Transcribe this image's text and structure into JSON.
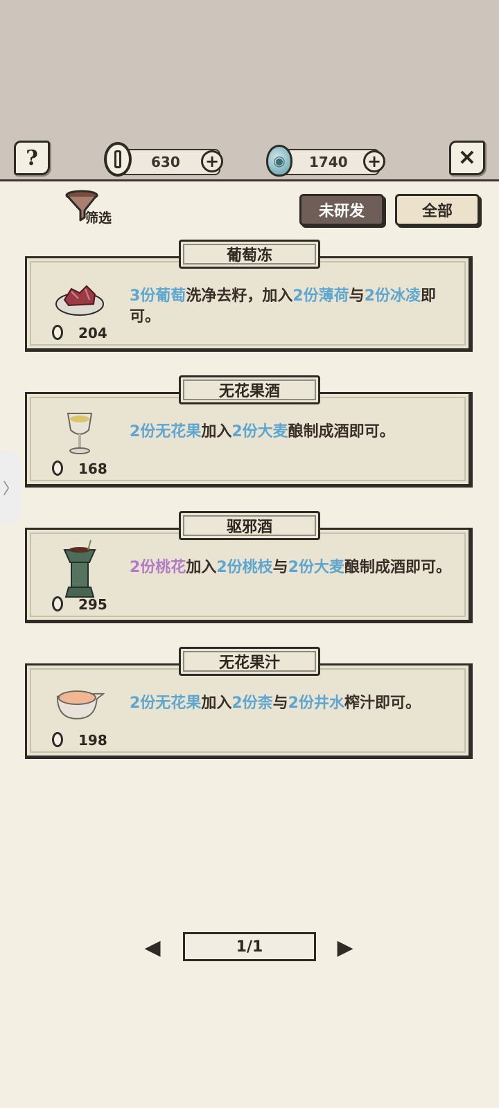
{
  "topbar": {
    "help_icon": "?",
    "close_icon": "✕",
    "coins": {
      "value": "630",
      "plus": "+"
    },
    "gems": {
      "value": "1740",
      "plus": "+"
    }
  },
  "filter": {
    "label": "筛选"
  },
  "tabs": [
    {
      "label": "未研发",
      "active": true
    },
    {
      "label": "全部",
      "active": false
    }
  ],
  "recipes": [
    {
      "title": "葡萄冻",
      "cost": "204",
      "icon": "grape-jelly-icon",
      "desc": [
        {
          "t": "3份葡萄",
          "c": "blue"
        },
        {
          "t": "洗净去籽，加入",
          "c": ""
        },
        {
          "t": "2份薄荷",
          "c": "blue"
        },
        {
          "t": "与",
          "c": ""
        },
        {
          "t": "2份冰凌",
          "c": "blue"
        },
        {
          "t": "即可。",
          "c": ""
        }
      ]
    },
    {
      "title": "无花果酒",
      "cost": "168",
      "icon": "wine-cup-icon",
      "desc": [
        {
          "t": "2份无花果",
          "c": "blue"
        },
        {
          "t": "加入",
          "c": ""
        },
        {
          "t": "2份大麦",
          "c": "blue"
        },
        {
          "t": "酿制成酒即可。",
          "c": ""
        }
      ]
    },
    {
      "title": "驱邪酒",
      "cost": "295",
      "icon": "bronze-vessel-icon",
      "desc": [
        {
          "t": "2份桃花",
          "c": "purple"
        },
        {
          "t": "加入",
          "c": ""
        },
        {
          "t": "2份桃枝",
          "c": "blue"
        },
        {
          "t": "与",
          "c": ""
        },
        {
          "t": "2份大麦",
          "c": "blue"
        },
        {
          "t": "酿制成酒即可。",
          "c": ""
        }
      ]
    },
    {
      "title": "无花果汁",
      "cost": "198",
      "icon": "juice-bowl-icon",
      "desc": [
        {
          "t": "2份无花果",
          "c": "blue"
        },
        {
          "t": "加入",
          "c": ""
        },
        {
          "t": "2份柰",
          "c": "blue"
        },
        {
          "t": "与",
          "c": ""
        },
        {
          "t": "2份井水",
          "c": "blue"
        },
        {
          "t": "榨汁即可。",
          "c": ""
        }
      ]
    }
  ],
  "pager": {
    "label": "1/1",
    "prev": "◀",
    "next": "▶"
  },
  "side_tab": {
    "label": "〉"
  },
  "colors": {
    "highlight_blue": "#5ea6cf",
    "highlight_purple": "#b27bc4",
    "active_tab": "#6f5e58"
  }
}
